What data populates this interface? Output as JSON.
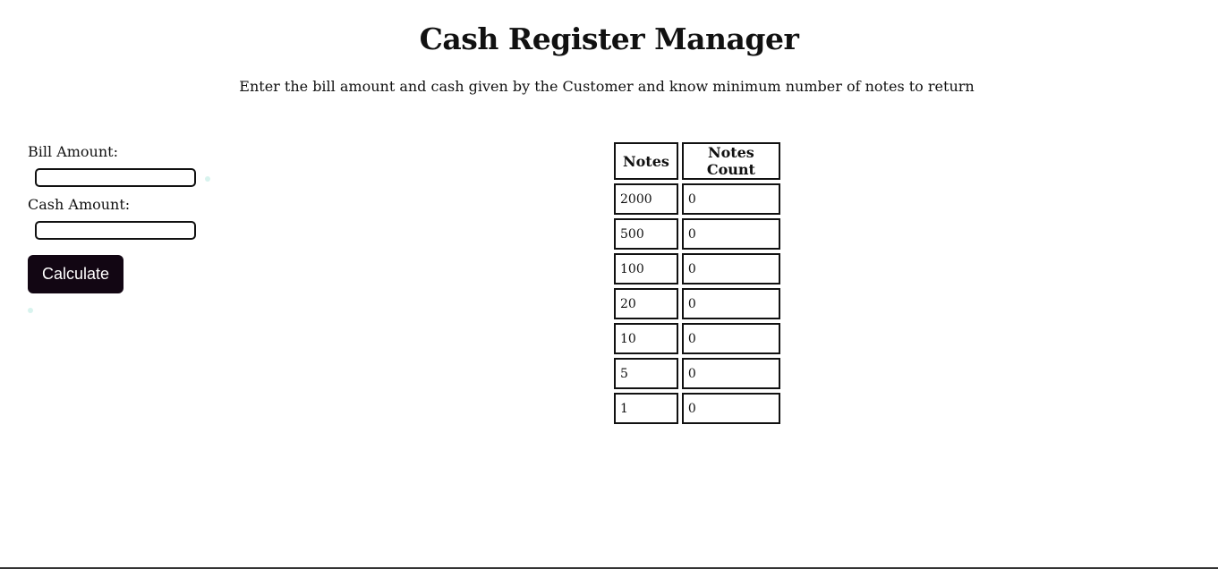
{
  "header": {
    "title": "Cash Register Manager",
    "subtitle": "Enter the bill amount and cash given by the Customer and know minimum number of notes to return"
  },
  "form": {
    "bill_label": "Bill Amount:",
    "bill_value": "",
    "cash_label": "Cash Amount:",
    "cash_value": "",
    "calculate_label": "Calculate"
  },
  "table": {
    "headers": [
      "Notes",
      "Notes Count"
    ],
    "rows": [
      {
        "note": "2000",
        "count": "0"
      },
      {
        "note": "500",
        "count": "0"
      },
      {
        "note": "100",
        "count": "0"
      },
      {
        "note": "20",
        "count": "0"
      },
      {
        "note": "10",
        "count": "0"
      },
      {
        "note": "5",
        "count": "0"
      },
      {
        "note": "1",
        "count": "0"
      }
    ]
  },
  "colors": {
    "button_bg": "#120613",
    "border": "#111111",
    "dot": "#d8f3ee"
  }
}
